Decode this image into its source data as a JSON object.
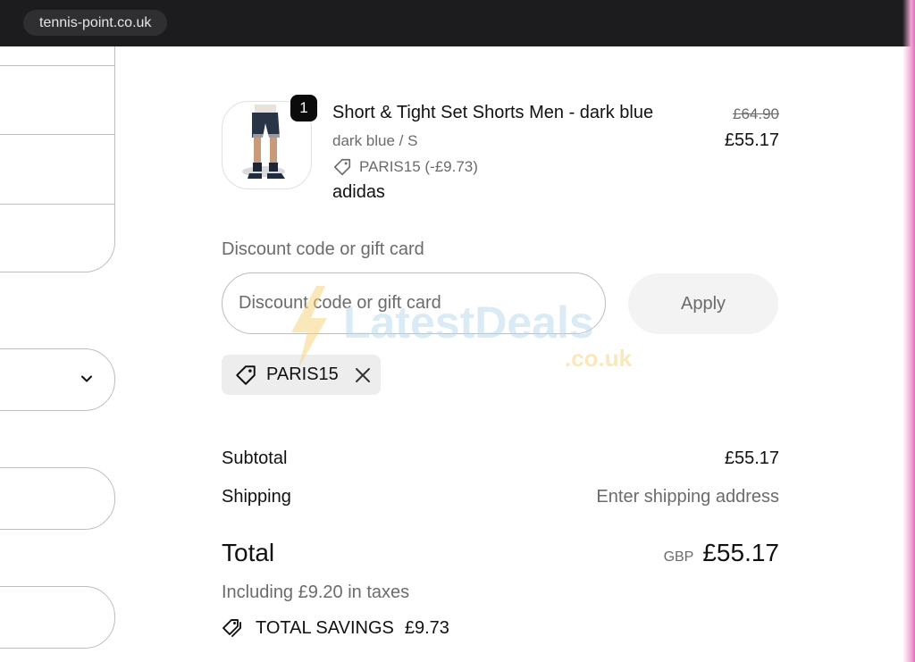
{
  "browser": {
    "url": "tennis-point.co.uk"
  },
  "product": {
    "quantity": "1",
    "title": "Short & Tight Set Shorts Men - dark blue",
    "variant": "dark blue / S",
    "discount_line": "PARIS15 (-£9.73)",
    "brand": "adidas",
    "original_price": "£64.90",
    "price": "£55.17"
  },
  "discount": {
    "label": "Discount code or gift card",
    "placeholder": "Discount code or gift card",
    "apply_label": "Apply",
    "applied_code": "PARIS15"
  },
  "summary": {
    "subtotal_label": "Subtotal",
    "subtotal_value": "£55.17",
    "shipping_label": "Shipping",
    "shipping_value": "Enter shipping address",
    "total_label": "Total",
    "currency": "GBP",
    "total_value": "£55.17",
    "taxes_note": "Including £9.20 in taxes",
    "savings_label": "TOTAL SAVINGS",
    "savings_value": "£9.73"
  },
  "watermark": {
    "brand": "LatestDeals",
    "suffix": ".co.uk"
  },
  "icons": {
    "tag": "tag-icon",
    "remove": "close-icon",
    "select": "chevron-down-icon",
    "savings": "tags-icon"
  },
  "colors": {
    "muted_text": "#6b6b6b",
    "border": "#bdbdbd",
    "chip_bg": "#ededed",
    "badge_bg": "#0b0b0b"
  }
}
